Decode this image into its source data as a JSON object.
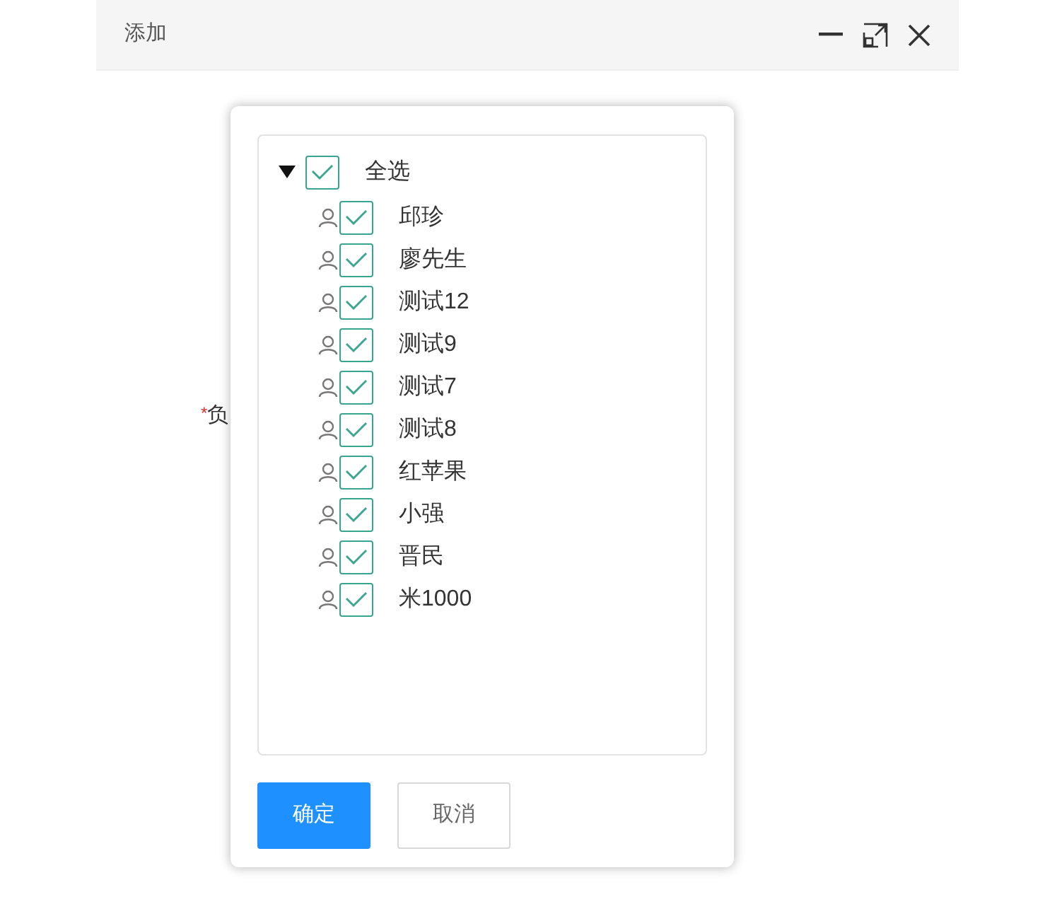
{
  "window": {
    "title": "添加"
  },
  "form": {
    "fields": [
      {
        "required_mark": "*",
        "label": "负"
      }
    ]
  },
  "popup": {
    "tree": {
      "label": "全选",
      "checked": true,
      "expanded": true,
      "children": [
        {
          "label": "邱珍",
          "checked": true
        },
        {
          "label": "廖先生",
          "checked": true
        },
        {
          "label": "测试12",
          "checked": true
        },
        {
          "label": "测试9",
          "checked": true
        },
        {
          "label": "测试7",
          "checked": true
        },
        {
          "label": "测试8",
          "checked": true
        },
        {
          "label": "红苹果",
          "checked": true
        },
        {
          "label": "小强",
          "checked": true
        },
        {
          "label": "晋民",
          "checked": true
        },
        {
          "label": "米1000",
          "checked": true
        }
      ]
    },
    "buttons": [
      {
        "label": "确定",
        "kind": "primary"
      },
      {
        "label": "取消",
        "kind": "default"
      }
    ]
  }
}
